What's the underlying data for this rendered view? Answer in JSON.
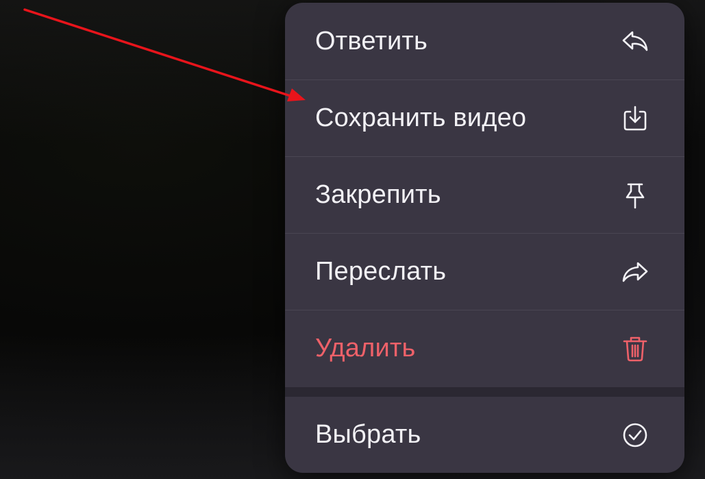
{
  "menu": {
    "items": [
      {
        "label": "Ответить",
        "icon": "reply-icon"
      },
      {
        "label": "Сохранить видео",
        "icon": "save-download-icon"
      },
      {
        "label": "Закрепить",
        "icon": "pin-icon"
      },
      {
        "label": "Переслать",
        "icon": "forward-icon"
      },
      {
        "label": "Удалить",
        "icon": "trash-icon",
        "destructive": true
      }
    ],
    "secondary_items": [
      {
        "label": "Выбрать",
        "icon": "checkmark-circle-icon"
      }
    ]
  },
  "colors": {
    "menu_background": "#3a3643",
    "text_primary": "#f2f1f5",
    "destructive": "#ee6169",
    "annotation_arrow": "#e8141b"
  }
}
